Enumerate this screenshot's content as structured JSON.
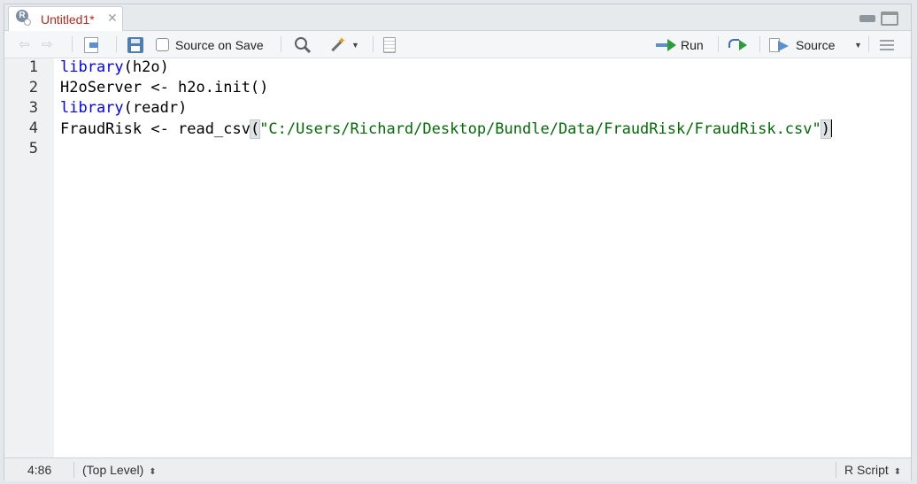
{
  "tab": {
    "title": "Untitled1*",
    "close_glyph": "✕",
    "logo": "R"
  },
  "toolbar": {
    "source_on_save_label": "Source on Save",
    "run_label": "Run",
    "source_label": "Source",
    "icons": [
      "back-arrow-icon",
      "forward-arrow-icon",
      "show-in-window-icon",
      "save-icon",
      "search-icon",
      "magic-wand-icon",
      "compile-report-icon",
      "run-icon",
      "rerun-icon",
      "source-icon",
      "outline-icon"
    ]
  },
  "editor": {
    "line_numbers": [
      "1",
      "2",
      "3",
      "4",
      "5"
    ],
    "lines": [
      {
        "kw": "library",
        "rest": "(h2o)"
      },
      {
        "text": "H2oServer <- h2o.init()"
      },
      {
        "kw": "library",
        "rest": "(readr)"
      },
      {
        "pre": "FraudRisk <- read_csv",
        "open": "(",
        "str": "\"C:/Users/Richard/Desktop/Bundle/Data/FraudRisk/FraudRisk.csv\"",
        "close": ")"
      },
      {
        "text": ""
      }
    ]
  },
  "status": {
    "position": "4:86",
    "scope": "(Top Level)",
    "file_type": "R Script"
  },
  "colors": {
    "keyword": "#0000ff",
    "string": "#036a07",
    "tab_title": "#b52a1d"
  }
}
